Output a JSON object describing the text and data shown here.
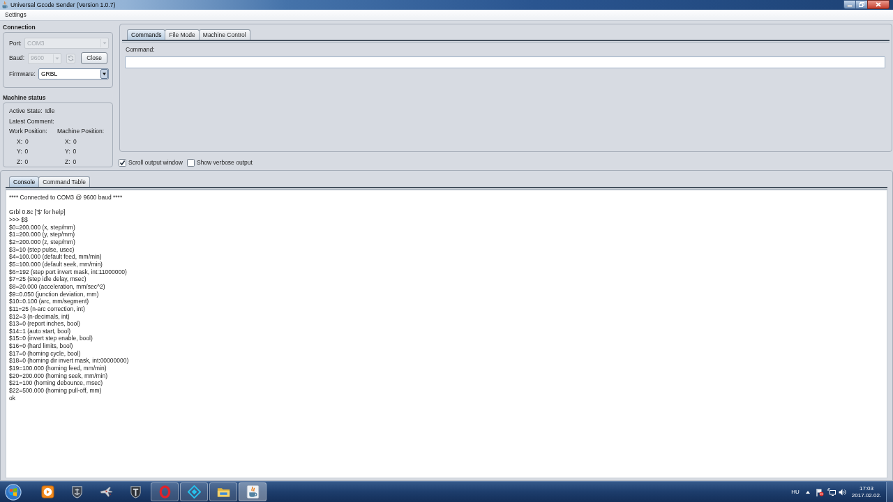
{
  "window": {
    "title": "Universal Gcode Sender (Version 1.0.7)"
  },
  "menu": [
    {
      "label": "Settings"
    }
  ],
  "connection": {
    "title": "Connection",
    "port": {
      "label": "Port:",
      "value": "COM3",
      "disabled": true
    },
    "baud": {
      "label": "Baud:",
      "value": "9600",
      "disabled": true
    },
    "close_button": {
      "label": "Close"
    },
    "firmware": {
      "label": "Firmware:",
      "value": "GRBL",
      "disabled": false
    }
  },
  "machine_status": {
    "title": "Machine status",
    "active_state": {
      "label": "Active State:",
      "value": "Idle"
    },
    "latest_comment": {
      "label": "Latest Comment:"
    },
    "work_position": {
      "label": "Work Position:",
      "axes": [
        {
          "label": "X:",
          "value": "0"
        },
        {
          "label": "Y:",
          "value": "0"
        },
        {
          "label": "Z:",
          "value": "0"
        }
      ]
    },
    "machine_position": {
      "label": "Machine Position:",
      "axes": [
        {
          "label": "X:",
          "value": "0"
        },
        {
          "label": "Y:",
          "value": "0"
        },
        {
          "label": "Z:",
          "value": "0"
        }
      ]
    }
  },
  "command_tabs": [
    {
      "label": "Commands",
      "selected": true
    },
    {
      "label": "File Mode",
      "selected": false
    },
    {
      "label": "Machine Control",
      "selected": false
    }
  ],
  "command": {
    "label": "Command:"
  },
  "options": [
    {
      "label": "Scroll output window",
      "checked": true
    },
    {
      "label": "Show verbose output",
      "checked": false
    }
  ],
  "output_tabs": [
    {
      "label": "Console",
      "selected": true
    },
    {
      "label": "Command Table",
      "selected": false
    }
  ],
  "console": {
    "blocks": [
      [
        "**** Connected to COM3 @ 9600 baud ****"
      ],
      [
        "Grbl 0.8c ['$' for help]",
        ">>> $$",
        "$0=200.000 (x, step/mm)",
        "$1=200.000 (y, step/mm)",
        "$2=200.000 (z, step/mm)",
        "$3=10 (step pulse, usec)",
        "$4=100.000 (default feed, mm/min)",
        "$5=100.000 (default seek, mm/min)",
        "$6=192 (step port invert mask, int:11000000)",
        "$7=25 (step idle delay, msec)",
        "$8=20.000 (acceleration, mm/sec^2)",
        "$9=0.050 (junction deviation, mm)",
        "$10=0.100 (arc, mm/segment)",
        "$11=25 (n-arc correction, int)",
        "$12=3 (n-decimals, int)",
        "$13=0 (report inches, bool)",
        "$14=1 (auto start, bool)",
        "$15=0 (invert step enable, bool)",
        "$16=0 (hard limits, bool)",
        "$17=0 (homing cycle, bool)",
        "$18=0 (homing dir invert mask, int:00000000)",
        "$19=100.000 (homing feed, mm/min)",
        "$20=200.000 (homing seek, mm/min)",
        "$21=100 (homing debounce, msec)",
        "$22=500.000 (homing pull-off, mm)",
        "ok"
      ]
    ]
  },
  "taskbar": {
    "items": [
      {
        "running": false,
        "selected": false
      },
      {
        "running": false,
        "selected": false
      },
      {
        "running": false,
        "selected": false
      },
      {
        "running": false,
        "selected": false
      },
      {
        "running": true,
        "selected": false
      },
      {
        "running": true,
        "selected": false
      },
      {
        "running": true,
        "selected": false
      },
      {
        "running": true,
        "selected": true
      }
    ],
    "language": "HU",
    "time": "17:03",
    "date": "2017.02.02."
  }
}
